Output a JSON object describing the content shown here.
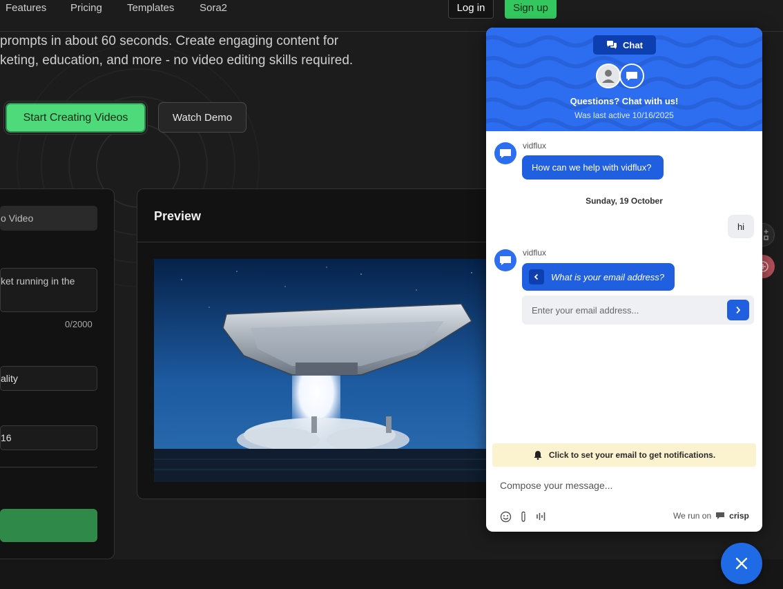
{
  "nav": {
    "links": [
      "Features",
      "Pricing",
      "Templates",
      "Sora2"
    ],
    "login": "Log in",
    "signup": "Sign up"
  },
  "hero": {
    "line1": "prompts in about 60 seconds. Create engaging content for",
    "line2": "keting, education, and more - no video editing skills required.",
    "start_button": "Start Creating Videos",
    "demo_button": "Watch Demo"
  },
  "form": {
    "mode_value": "o Video",
    "prompt_value": "ket running in the",
    "char_counter": "0/2000",
    "quality_value": "ality",
    "ratio_value": "16"
  },
  "preview": {
    "title": "Preview"
  },
  "chat": {
    "tab_label": "Chat",
    "header_title": "Questions? Chat with us!",
    "header_subtitle": "Was last active 10/16/2025",
    "operator_name": "vidflux",
    "greeting": "How can we help with vidflux?",
    "date_separator": "Sunday, 19 October",
    "user_message": "hi",
    "email_question": "What is your email address?",
    "email_placeholder": "Enter your email address...",
    "notify_text": "Click to set your email to get notifications.",
    "compose_placeholder": "Compose your message...",
    "we_run_on": "We run on",
    "brand": "crisp"
  },
  "colors": {
    "accent_green": "#4ed97a",
    "chat_blue": "#2d6df0",
    "bubble_blue": "#1f5fe0",
    "notify_yellow": "#fbf2d0"
  }
}
